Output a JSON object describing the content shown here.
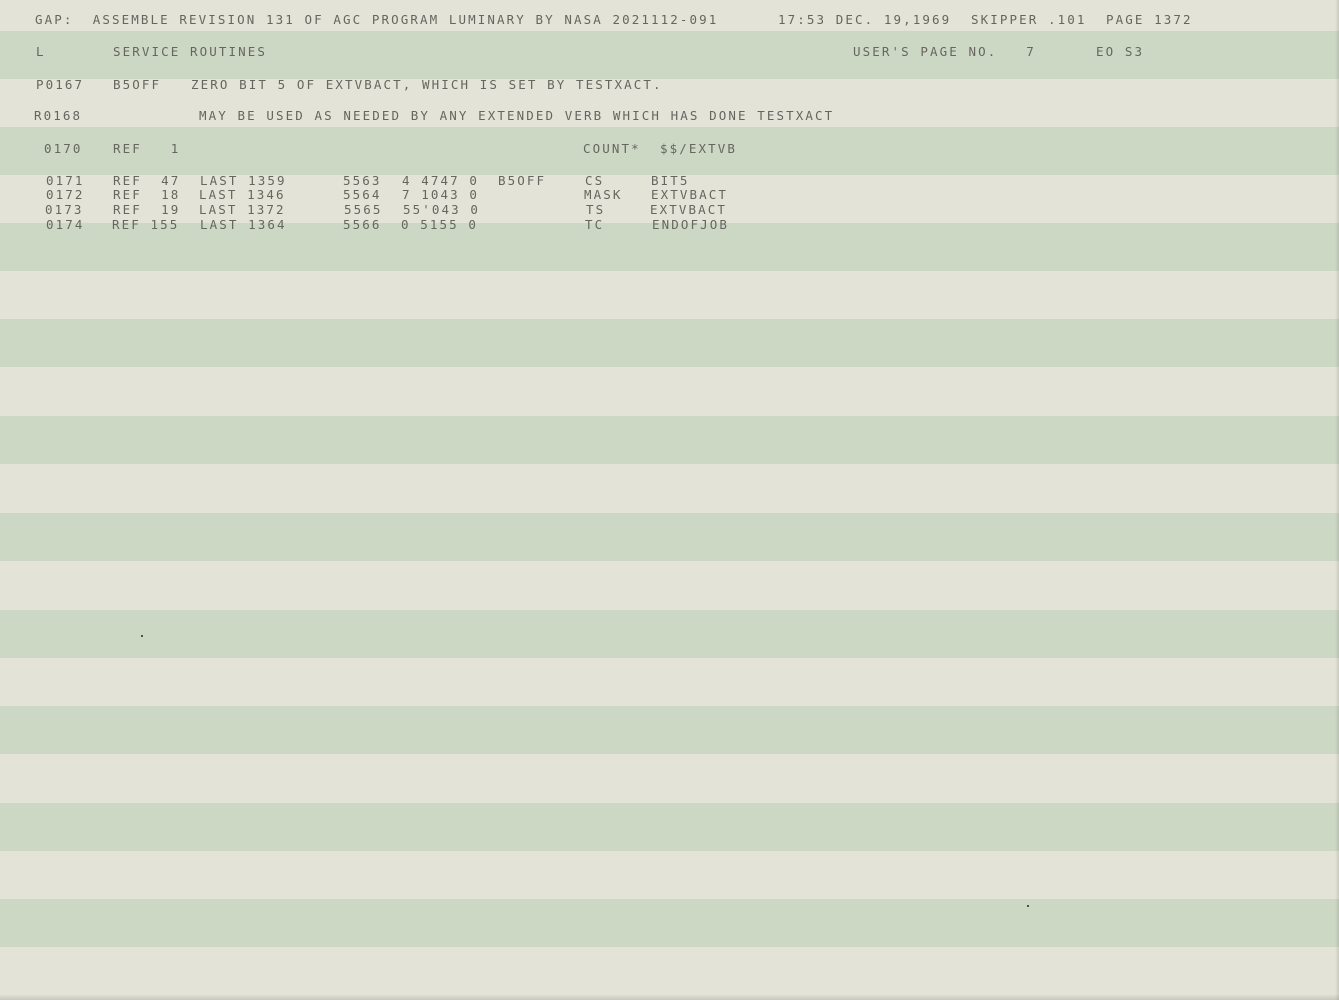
{
  "header": {
    "left": "GAP:  ASSEMBLE REVISION 131 OF AGC PROGRAM LUMINARY BY NASA 2021112-091",
    "time": "17:53 DEC. 19,1969",
    "skipper": "SKIPPER .101",
    "page": "PAGE 1372"
  },
  "section": {
    "tag": "L",
    "title": "SERVICE ROUTINES",
    "users_page": "USER'S PAGE NO.   7",
    "code": "EO S3"
  },
  "comments": [
    {
      "id": "P0167",
      "symbol": "B5OFF",
      "text": "ZERO BIT 5 OF EXTVBACT, WHICH IS SET BY TESTXACT."
    },
    {
      "id": "R0168",
      "symbol": "",
      "text": "MAY BE USED AS NEEDED BY ANY EXTENDED VERB WHICH HAS DONE TESTXACT"
    }
  ],
  "count_line": {
    "id": "0170",
    "ref": "REF   1",
    "count": "COUNT*  $$/EXTVB"
  },
  "listing": {
    "rows": [
      {
        "line": "0171",
        "ref": "REF  47",
        "last": "LAST 1359",
        "addr": "5563",
        "word": "4 4747 0",
        "label": "B5OFF",
        "op": "CS",
        "operand": "BIT5"
      },
      {
        "line": "0172",
        "ref": "REF  18",
        "last": "LAST 1346",
        "addr": "5564",
        "word": "7 1043 0",
        "label": "",
        "op": "MASK",
        "operand": "EXTVBACT"
      },
      {
        "line": "0173",
        "ref": "REF  19",
        "last": "LAST 1372",
        "addr": "5565",
        "word": "55'043 0",
        "label": "",
        "op": "TS",
        "operand": "EXTVBACT"
      },
      {
        "line": "0174",
        "ref": "REF 155",
        "last": "LAST 1364",
        "addr": "5566",
        "word": "0 5155 0",
        "label": "",
        "op": "TC",
        "operand": "ENDOFJOB"
      }
    ]
  },
  "colors": {
    "paper": "#e4e3d8",
    "band": "#cdd8c4",
    "ink": "#66665f"
  }
}
